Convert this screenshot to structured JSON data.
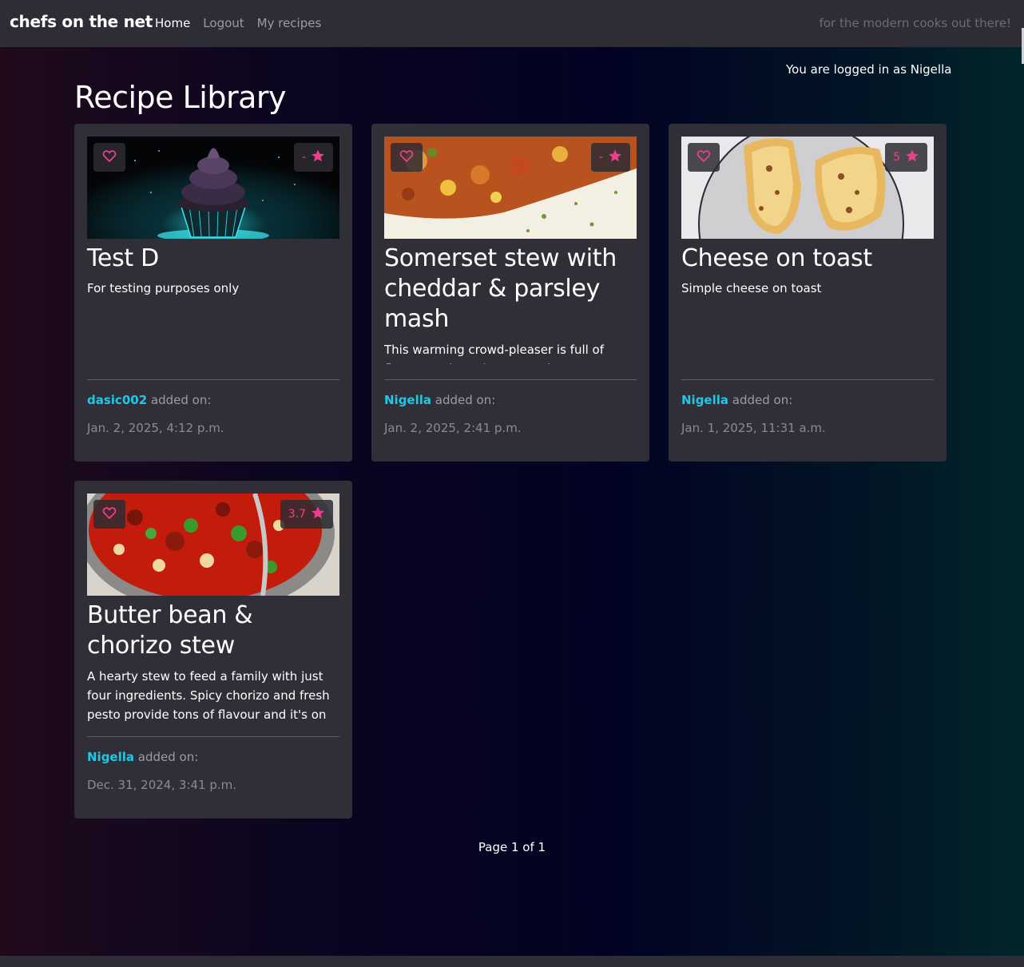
{
  "nav": {
    "brand": "chefs on the net",
    "links": [
      "Home",
      "Logout",
      "My recipes"
    ],
    "tagline": "for the modern cooks out there!"
  },
  "user_status": "You are logged in as Nigella",
  "page_title": "Recipe Library",
  "recipes": [
    {
      "title": "Test D",
      "description": "For testing purposes only",
      "rating": "-",
      "author": "dasic002",
      "added_label": "added on:",
      "date": "Jan. 2, 2025, 4:12 p.m."
    },
    {
      "title": "Somerset stew with cheddar & parsley mash",
      "description": "This warming crowd-pleaser is full of flavour and goodness. Use just one tray of beef if",
      "rating": "-",
      "author": "Nigella",
      "added_label": "added on:",
      "date": "Jan. 2, 2025, 2:41 p.m."
    },
    {
      "title": "Cheese on toast",
      "description": "Simple cheese on toast",
      "rating": "5",
      "author": "Nigella",
      "added_label": "added on:",
      "date": "Jan. 1, 2025, 11:31 a.m."
    },
    {
      "title": "Butter bean & chorizo stew",
      "description": "A hearty stew to feed a family with just four ingredients. Spicy chorizo and fresh pesto provide tons of flavour and it's on the table",
      "rating": "3.7",
      "author": "Nigella",
      "added_label": "added on:",
      "date": "Dec. 31, 2024, 3:41 p.m."
    }
  ],
  "pagination": "Page 1 of 1",
  "colors": {
    "accent_pink": "#ef3e8e",
    "author_cyan": "#1fc8e6",
    "card_bg": "#302f37"
  }
}
